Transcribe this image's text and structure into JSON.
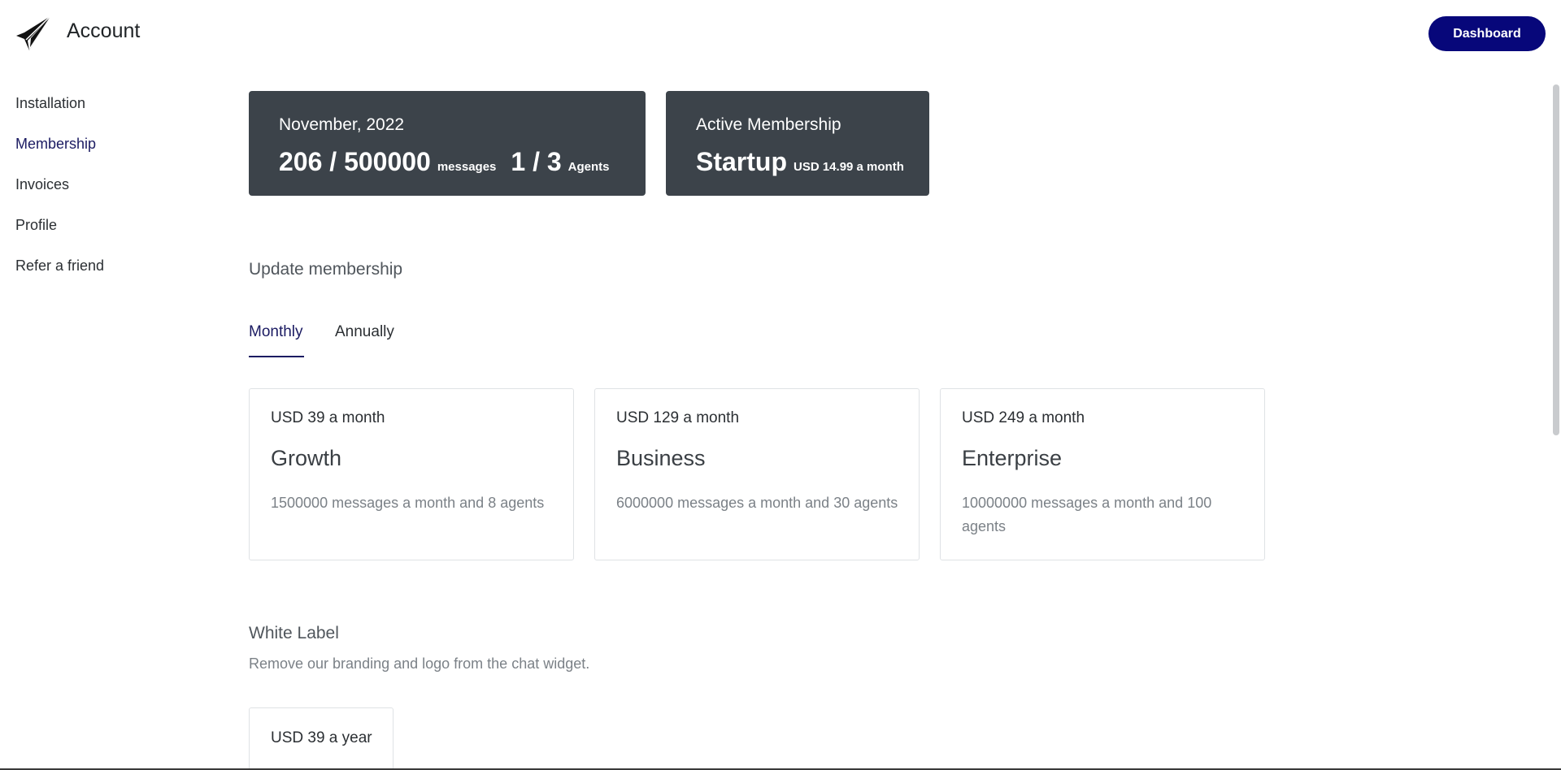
{
  "header": {
    "app_title": "Account",
    "dashboard_label": "Dashboard",
    "logo_icon": "paper-plane-logo",
    "accent_color": "#07077a"
  },
  "sidebar": {
    "items": [
      {
        "label": "Installation",
        "active": false
      },
      {
        "label": "Membership",
        "active": true
      },
      {
        "label": "Invoices",
        "active": false
      },
      {
        "label": "Profile",
        "active": false
      },
      {
        "label": "Refer a friend",
        "active": false
      }
    ]
  },
  "usage": {
    "period": "November, 2022",
    "messages_value": "206 / 500000",
    "messages_unit": "messages",
    "agents_value": "1 / 3",
    "agents_unit": "Agents"
  },
  "active_membership": {
    "label": "Active Membership",
    "plan": "Startup",
    "price": "USD 14.99 a month"
  },
  "update": {
    "title": "Update membership",
    "tabs": [
      {
        "label": "Monthly",
        "active": true
      },
      {
        "label": "Annually",
        "active": false
      }
    ],
    "plans": [
      {
        "price": "USD 39 a month",
        "name": "Growth",
        "description": "1500000 messages a month and 8 agents"
      },
      {
        "price": "USD 129 a month",
        "name": "Business",
        "description": "6000000 messages a month and 30 agents"
      },
      {
        "price": "USD 249 a month",
        "name": "Enterprise",
        "description": "10000000 messages a month and 100 agents"
      }
    ]
  },
  "white_label": {
    "title": "White Label",
    "description": "Remove our branding and logo from the chat widget.",
    "price": "USD 39 a year"
  }
}
